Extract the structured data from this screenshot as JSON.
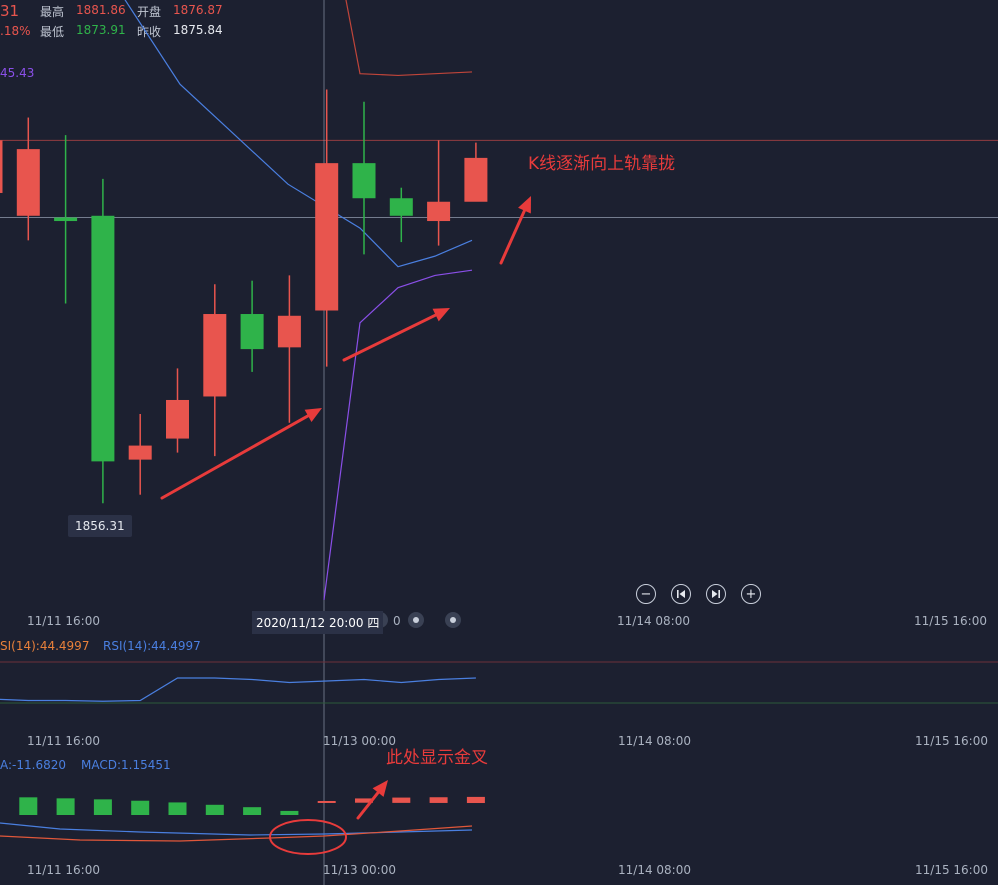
{
  "header": {
    "price_partial": "31",
    "change_partial": ".18%",
    "high_label": "最高",
    "high_value": "1881.86",
    "open_label": "开盘",
    "open_value": "1876.87",
    "low_label": "最低",
    "low_value": "1873.91",
    "prev_close_label": "昨收",
    "prev_close_value": "1875.84",
    "boll_lower_partial": "45.43"
  },
  "tooltip_low": "1856.31",
  "crosshair_time": "2020/11/12 20:00 四",
  "crosshair_time_partial_tail": "0",
  "main_x_ticks": [
    "11/11 16:00",
    "11/14 08:00",
    "11/15 16:00"
  ],
  "rsi_labels": [
    "SI(14):44.4997",
    "RSI(14):44.4997"
  ],
  "rsi_x_ticks": [
    "11/11 16:00",
    "11/13 00:00",
    "11/14 08:00",
    "11/15 16:00"
  ],
  "macd_labels": [
    "A:-11.6820",
    "MACD:1.15451"
  ],
  "macd_x_ticks": [
    "11/11 16:00",
    "11/13 00:00",
    "11/14 08:00",
    "11/15 16:00"
  ],
  "annotations": {
    "top": "K线逐渐向上轨靠拢",
    "bottom": "此处显示金叉"
  },
  "controls": [
    "zoom-out",
    "step-back",
    "step-forward",
    "zoom-in"
  ],
  "colors": {
    "up": "#e8554e",
    "down": "#2fb34a",
    "boll_mid": "#4a7fe0",
    "boll_lower": "#8a4fe8",
    "boll_upper": "#c0453a",
    "annotation": "#e83b3b"
  },
  "chart_data": [
    {
      "type": "candlestick",
      "price_range": [
        1850.0,
        1885.0
      ],
      "candles": [
        {
          "open": 1874.0,
          "close": 1877.0,
          "high": 1878.0,
          "low": 1873.5
        },
        {
          "open": 1872.7,
          "close": 1876.5,
          "high": 1878.3,
          "low": 1871.3
        },
        {
          "open": 1872.6,
          "close": 1872.4,
          "high": 1877.3,
          "low": 1867.7
        },
        {
          "open": 1872.7,
          "close": 1858.7,
          "high": 1874.8,
          "low": 1856.31
        },
        {
          "open": 1858.8,
          "close": 1859.6,
          "high": 1861.4,
          "low": 1856.8
        },
        {
          "open": 1860.0,
          "close": 1862.2,
          "high": 1864.0,
          "low": 1859.2
        },
        {
          "open": 1862.4,
          "close": 1867.1,
          "high": 1868.8,
          "low": 1859.0
        },
        {
          "open": 1867.1,
          "close": 1865.1,
          "high": 1869.0,
          "low": 1863.8
        },
        {
          "open": 1865.2,
          "close": 1867.0,
          "high": 1869.3,
          "low": 1860.9
        },
        {
          "open": 1867.3,
          "close": 1875.7,
          "high": 1879.9,
          "low": 1864.1
        },
        {
          "open": 1875.7,
          "close": 1873.7,
          "high": 1879.2,
          "low": 1870.5
        },
        {
          "open": 1873.7,
          "close": 1872.7,
          "high": 1874.3,
          "low": 1871.2
        },
        {
          "open": 1872.4,
          "close": 1873.5,
          "high": 1877.0,
          "low": 1871.0
        },
        {
          "open": 1873.5,
          "close": 1876.0,
          "high": 1876.87,
          "low": 1873.91
        }
      ],
      "boll_mid": [
        1886.5,
        1880.2,
        1874.5,
        1872.0,
        1869.8,
        1870.4,
        1871.3
      ],
      "boll_upper": [
        1888.0,
        1880.8,
        1880.7,
        1880.9
      ],
      "boll_lower": [
        1850.8,
        1866.6,
        1868.6,
        1869.3,
        1869.6
      ]
    },
    {
      "type": "line",
      "name": "RSI(14)",
      "values": [
        34,
        33,
        33,
        32.5,
        33,
        48,
        48,
        47,
        45,
        46,
        47,
        45,
        47,
        48
      ]
    },
    {
      "type": "bar",
      "name": "MACD",
      "values": [
        -5.2,
        -4.9,
        -4.6,
        -4.2,
        -3.7,
        -3.0,
        -2.3,
        -1.2,
        0.6,
        2.1,
        2.6,
        2.8,
        3.0
      ]
    }
  ]
}
